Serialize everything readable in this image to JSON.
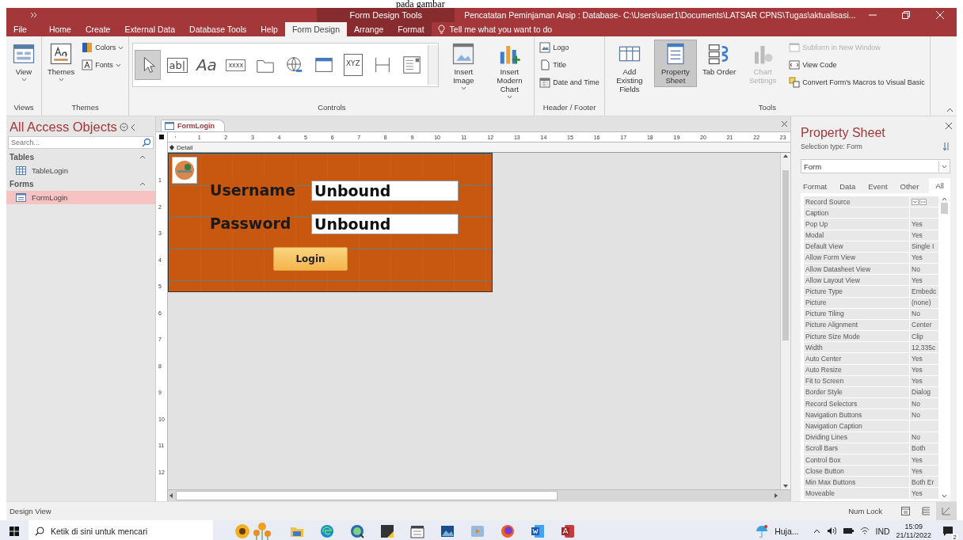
{
  "document_fragment": "pada gambar",
  "window": {
    "context_title": "Form Design Tools",
    "title": "Pencatatan Peminjaman Arsip : Database- C:\\Users\\user1\\Documents\\LATSAR CPNS\\Tugas\\aktualisasi..."
  },
  "ribbon_tabs": [
    {
      "label": "File",
      "selected": false,
      "contextual": false
    },
    {
      "label": "Home",
      "selected": false,
      "contextual": false
    },
    {
      "label": "Create",
      "selected": false,
      "contextual": false
    },
    {
      "label": "External Data",
      "selected": false,
      "contextual": false
    },
    {
      "label": "Database Tools",
      "selected": false,
      "contextual": false
    },
    {
      "label": "Help",
      "selected": false,
      "contextual": false
    },
    {
      "label": "Form Design",
      "selected": true,
      "contextual": true
    },
    {
      "label": "Arrange",
      "selected": false,
      "contextual": true
    },
    {
      "label": "Format",
      "selected": false,
      "contextual": true
    }
  ],
  "tell_me": "Tell me what you want to do",
  "ribbon_groups": [
    {
      "label": "Views",
      "items": [
        {
          "kind": "large",
          "label": "View",
          "dropdown": true,
          "selected": false,
          "disabled": false
        }
      ]
    },
    {
      "label": "Themes",
      "items": [
        {
          "kind": "large",
          "label": "Themes",
          "dropdown": true,
          "selected": false,
          "disabled": false
        },
        {
          "kind": "small",
          "label": "Colors",
          "dropdown": true,
          "selected": false,
          "disabled": false
        },
        {
          "kind": "small",
          "label": "Fonts",
          "dropdown": true,
          "selected": false,
          "disabled": false
        }
      ]
    },
    {
      "label": "Controls",
      "items": [
        {
          "kind": "gallery",
          "controls": [
            {
              "kind": "pointer",
              "selected": true
            },
            {
              "kind": "textbox",
              "glyph": "ab|",
              "selected": false
            },
            {
              "kind": "label",
              "glyph": "Aa",
              "selected": false
            },
            {
              "kind": "button",
              "glyph": "xxxx",
              "selected": false
            },
            {
              "kind": "tab",
              "selected": false
            },
            {
              "kind": "hyperlink",
              "selected": false
            },
            {
              "kind": "browser",
              "selected": false
            },
            {
              "kind": "group",
              "glyph": "XYZ",
              "selected": false
            },
            {
              "kind": "pagebreak",
              "selected": false
            },
            {
              "kind": "combo",
              "selected": false
            }
          ]
        },
        {
          "kind": "large",
          "label": "Insert Image",
          "dropdown": true,
          "selected": false,
          "disabled": false
        },
        {
          "kind": "large",
          "label": "Insert Modern Chart",
          "dropdown": true,
          "selected": false,
          "disabled": false
        }
      ]
    },
    {
      "label": "Header / Footer",
      "items": [
        {
          "kind": "small",
          "label": "Logo",
          "dropdown": false,
          "selected": false,
          "disabled": false
        },
        {
          "kind": "small",
          "label": "Title",
          "dropdown": false,
          "selected": false,
          "disabled": false
        },
        {
          "kind": "small",
          "label": "Date and Time",
          "dropdown": false,
          "selected": false,
          "disabled": false
        }
      ]
    },
    {
      "label": "Tools",
      "items": [
        {
          "kind": "large",
          "label": "Add Existing Fields",
          "dropdown": false,
          "selected": false,
          "disabled": false
        },
        {
          "kind": "large",
          "label": "Property Sheet",
          "dropdown": false,
          "selected": true,
          "disabled": false
        },
        {
          "kind": "large",
          "label": "Tab Order",
          "dropdown": false,
          "selected": false,
          "disabled": false
        },
        {
          "kind": "large",
          "label": "Chart Settings",
          "dropdown": false,
          "selected": false,
          "disabled": true
        },
        {
          "kind": "small",
          "label": "Subform in New Window",
          "dropdown": false,
          "selected": false,
          "disabled": true
        },
        {
          "kind": "small",
          "label": "View Code",
          "dropdown": false,
          "selected": false,
          "disabled": false
        },
        {
          "kind": "small",
          "label": "Convert Form's Macros to Visual Basic",
          "dropdown": false,
          "selected": false,
          "disabled": false
        }
      ]
    }
  ],
  "nav_pane": {
    "title": "All Access Objects",
    "search": {
      "placeholder": "Search..."
    },
    "groups": [
      {
        "label": "Tables",
        "expanded": true,
        "items": [
          {
            "label": "TableLogin",
            "kind": "table",
            "selected": false
          }
        ]
      },
      {
        "label": "Forms",
        "expanded": true,
        "items": [
          {
            "label": "FormLogin",
            "kind": "form",
            "selected": true
          }
        ]
      }
    ]
  },
  "document_tabs": [
    {
      "label": "FormLogin",
      "selected": true
    }
  ],
  "ruler_horizontal": [
    "1",
    "2",
    "3",
    "4",
    "5",
    "6",
    "7",
    "8",
    "9",
    "10",
    "11",
    "12",
    "13",
    "14",
    "15",
    "16",
    "17",
    "18",
    "19",
    "20",
    "21",
    "22",
    "23"
  ],
  "ruler_vertical": [
    "1",
    "2",
    "3",
    "4",
    "5",
    "6",
    "7",
    "8",
    "9",
    "10",
    "11",
    "12"
  ],
  "section": "Detail",
  "form": {
    "fields": [
      {
        "label": "Username",
        "value": "Unbound"
      },
      {
        "label": "Password",
        "value": "Unbound"
      }
    ],
    "button": "Login"
  },
  "property_sheet": {
    "title": "Property Sheet",
    "selection_label": "Selection type:",
    "selection_value": "Form",
    "object": "Form",
    "tabs": [
      {
        "label": "Format",
        "selected": false
      },
      {
        "label": "Data",
        "selected": false
      },
      {
        "label": "Event",
        "selected": false
      },
      {
        "label": "Other",
        "selected": false
      },
      {
        "label": "All",
        "selected": true
      }
    ],
    "rows": [
      [
        "Record Source",
        ""
      ],
      [
        "Caption",
        ""
      ],
      [
        "Pop Up",
        "Yes"
      ],
      [
        "Modal",
        "Yes"
      ],
      [
        "Default View",
        "Single I"
      ],
      [
        "Allow Form View",
        "Yes"
      ],
      [
        "Allow Datasheet View",
        "No"
      ],
      [
        "Allow Layout View",
        "Yes"
      ],
      [
        "Picture Type",
        "Embedc"
      ],
      [
        "Picture",
        "(none)"
      ],
      [
        "Picture Tiling",
        "No"
      ],
      [
        "Picture Alignment",
        "Center"
      ],
      [
        "Picture Size Mode",
        "Clip"
      ],
      [
        "Width",
        "12,335c"
      ],
      [
        "Auto Center",
        "Yes"
      ],
      [
        "Auto Resize",
        "Yes"
      ],
      [
        "Fit to Screen",
        "Yes"
      ],
      [
        "Border Style",
        "Dialog"
      ],
      [
        "Record Selectors",
        "No"
      ],
      [
        "Navigation Buttons",
        "No"
      ],
      [
        "Navigation Caption",
        ""
      ],
      [
        "Dividing Lines",
        "No"
      ],
      [
        "Scroll Bars",
        "Both"
      ],
      [
        "Control Box",
        "Yes"
      ],
      [
        "Close Button",
        "Yes"
      ],
      [
        "Min Max Buttons",
        "Both Er"
      ],
      [
        "Moveable",
        "Yes"
      ]
    ]
  },
  "status_bar": {
    "left": "Design View",
    "indicator": "Num Lock"
  },
  "taskbar": {
    "search_placeholder": "Ketik di sini untuk mencari",
    "weather": "Huja...",
    "language": "IND",
    "time": "15:09",
    "date": "21/11/2022",
    "notifications": "2"
  }
}
